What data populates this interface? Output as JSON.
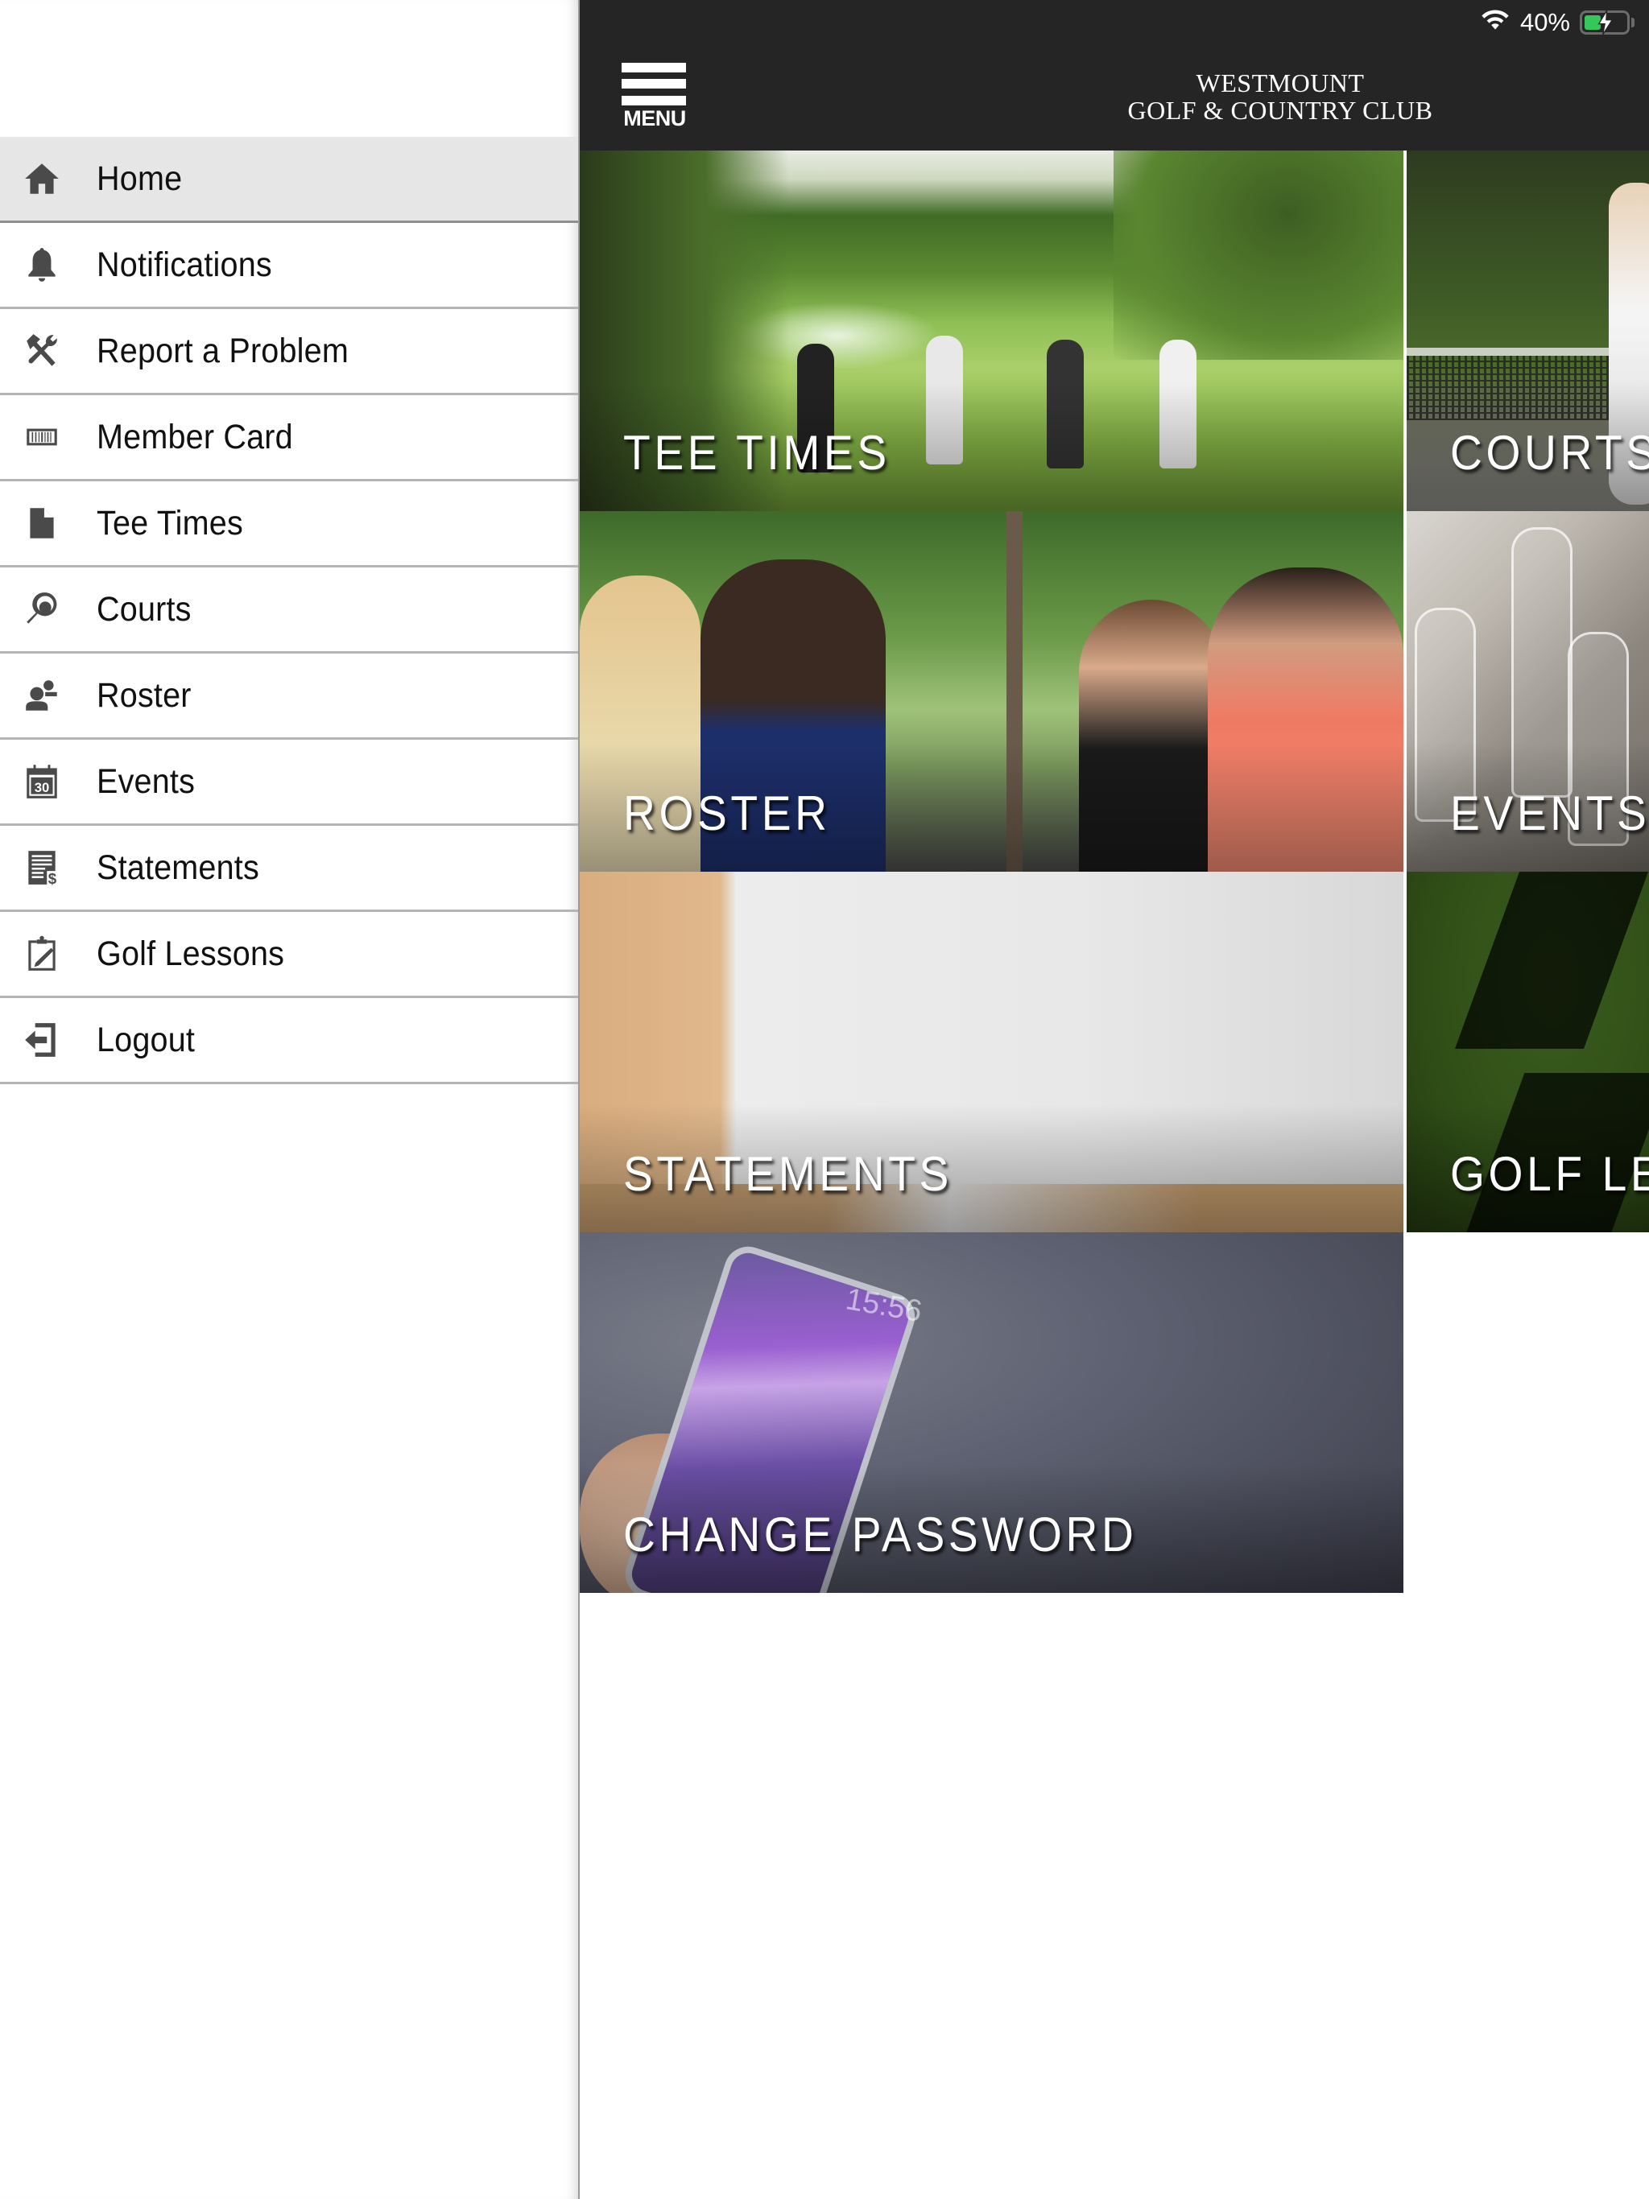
{
  "status_bar": {
    "wifi_icon": "wifi-icon",
    "battery_percent": "40%",
    "battery_level": 0.4,
    "battery_charging": true,
    "battery_color": "#34c759"
  },
  "header": {
    "menu_label": "MENU",
    "club_name_line1": "WESTMOUNT",
    "club_name_line2": "GOLF & COUNTRY CLUB",
    "background_color": "#252525"
  },
  "sidebar": {
    "active_item": "Home",
    "active_background": "#e6e6e6",
    "items": [
      {
        "label": "Home",
        "icon": "home-icon"
      },
      {
        "label": "Notifications",
        "icon": "bell-icon"
      },
      {
        "label": "Report a Problem",
        "icon": "tools-icon"
      },
      {
        "label": "Member Card",
        "icon": "barcode-icon"
      },
      {
        "label": "Tee Times",
        "icon": "document-icon"
      },
      {
        "label": "Courts",
        "icon": "tennis-racket-icon"
      },
      {
        "label": "Roster",
        "icon": "people-icon"
      },
      {
        "label": "Events",
        "icon": "calendar-icon",
        "icon_text": "30"
      },
      {
        "label": "Statements",
        "icon": "statement-dollar-icon"
      },
      {
        "label": "Golf Lessons",
        "icon": "clipboard-pencil-icon"
      },
      {
        "label": "Logout",
        "icon": "logout-icon"
      }
    ]
  },
  "tiles": [
    {
      "label": "TEE TIMES"
    },
    {
      "label": "COURTS"
    },
    {
      "label": "ROSTER"
    },
    {
      "label": "EVENTS"
    },
    {
      "label": "STATEMENTS"
    },
    {
      "label": "GOLF LE"
    },
    {
      "label": "CHANGE PASSWORD"
    }
  ],
  "tile_images": {
    "change_password_phone_clock": "15:56"
  }
}
